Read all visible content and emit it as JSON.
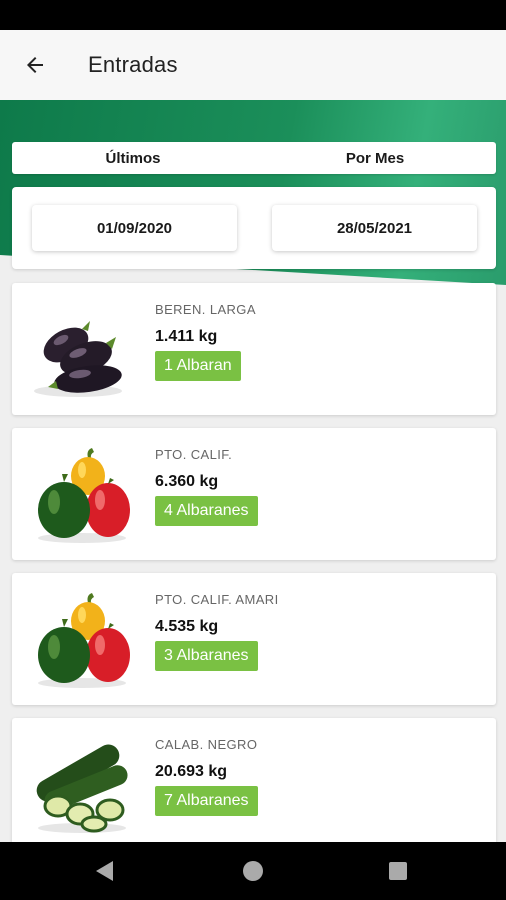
{
  "app_bar": {
    "title": "Entradas",
    "back_icon": "arrow-left-icon"
  },
  "tabs": [
    {
      "label": "Últimos"
    },
    {
      "label": "Por Mes"
    }
  ],
  "date_range": {
    "from": "01/09/2020",
    "to": "28/05/2021"
  },
  "items": [
    {
      "name": "BEREN. LARGA",
      "weight": "1.411 kg",
      "badge": "1 Albaran",
      "image": "eggplant-image"
    },
    {
      "name": "PTO. CALIF.",
      "weight": "6.360 kg",
      "badge": "4 Albaranes",
      "image": "bell-peppers-image"
    },
    {
      "name": "PTO. CALIF. AMARI",
      "weight": "4.535 kg",
      "badge": "3 Albaranes",
      "image": "bell-peppers-image"
    },
    {
      "name": "CALAB. NEGRO",
      "weight": "20.693 kg",
      "badge": "7 Albaranes",
      "image": "zucchini-image"
    }
  ],
  "colors": {
    "accent_green": "#7ac143",
    "banner_green": "#1b8f5a"
  },
  "system_nav": {
    "back": "nav-back-icon",
    "home": "nav-home-icon",
    "recents": "nav-recents-icon"
  }
}
